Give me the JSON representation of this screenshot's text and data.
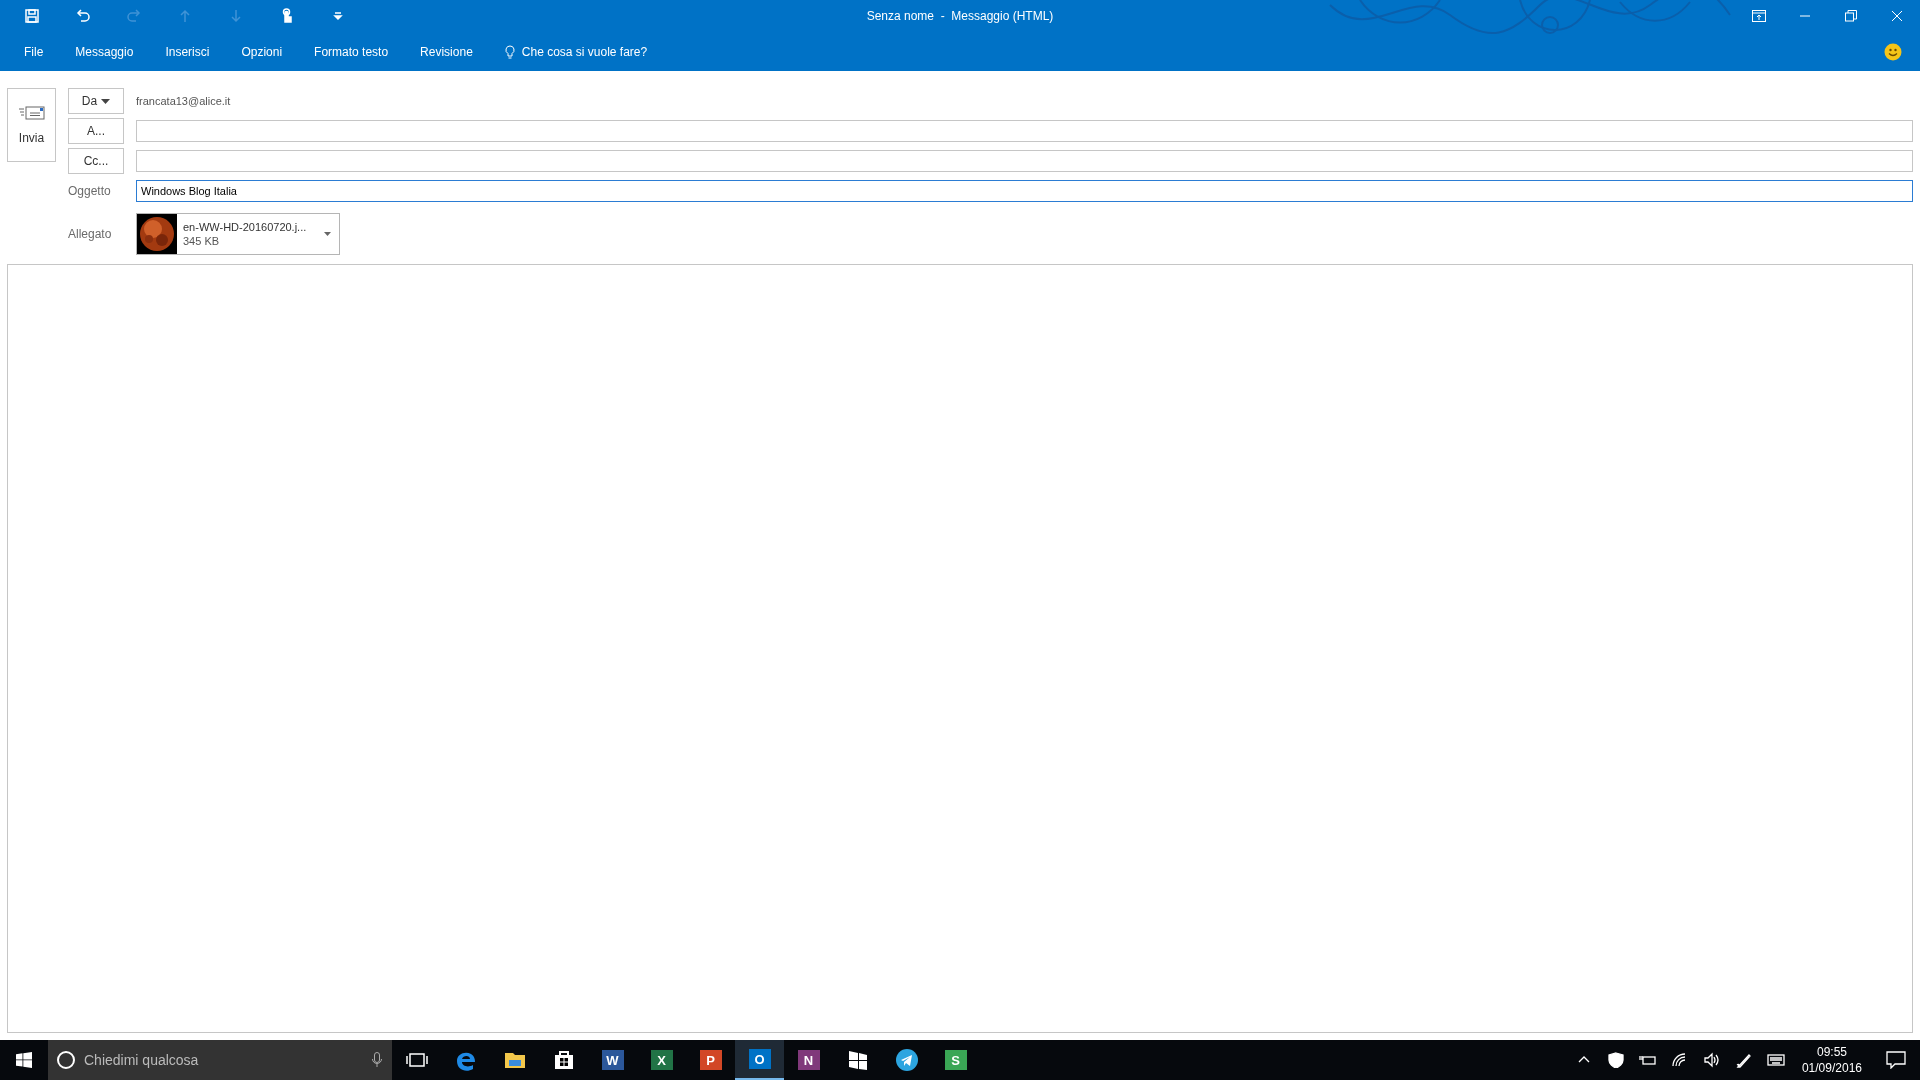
{
  "window": {
    "title": "Senza nome  -  Messaggio (HTML)"
  },
  "ribbon_tabs": [
    {
      "label": "File",
      "selected": false
    },
    {
      "label": "Messaggio",
      "selected": false
    },
    {
      "label": "Inserisci",
      "selected": false
    },
    {
      "label": "Opzioni",
      "selected": false
    },
    {
      "label": "Formato testo",
      "selected": false
    },
    {
      "label": "Revisione",
      "selected": false
    }
  ],
  "tell_me": {
    "placeholder": "Che cosa si vuole fare?"
  },
  "quick_access": [
    {
      "kind": "save",
      "disabled": false
    },
    {
      "kind": "undo",
      "disabled": false
    },
    {
      "kind": "redo",
      "disabled": true
    },
    {
      "kind": "up",
      "disabled": true
    },
    {
      "kind": "down",
      "disabled": true
    },
    {
      "kind": "touch",
      "disabled": false
    },
    {
      "kind": "customize",
      "disabled": false
    }
  ],
  "send_button": {
    "label": "Invia"
  },
  "from": {
    "label": "Da",
    "value": "francata13@alice.it"
  },
  "to": {
    "label": "A..."
  },
  "cc": {
    "label": "Cc..."
  },
  "subject": {
    "label": "Oggetto",
    "value": "Windows Blog Italia"
  },
  "attachment": {
    "label": "Allegato",
    "name": "en-WW-HD-20160720.j...",
    "size": "345 KB"
  },
  "taskbar": {
    "search": {
      "placeholder": "Chiedimi qualcosa"
    },
    "apps": [
      {
        "kind": "taskview",
        "selected": false
      },
      {
        "kind": "edge",
        "selected": false
      },
      {
        "kind": "explorer",
        "selected": false
      },
      {
        "kind": "store",
        "selected": false
      },
      {
        "kind": "tile",
        "glyph": "W",
        "color": "#2b579a",
        "selected": false
      },
      {
        "kind": "tile",
        "glyph": "X",
        "color": "#217346",
        "selected": false
      },
      {
        "kind": "tile",
        "glyph": "P",
        "color": "#d24726",
        "selected": false
      },
      {
        "kind": "tile",
        "glyph": "O",
        "color": "#0072c6",
        "selected": true
      },
      {
        "kind": "tile",
        "glyph": "N",
        "color": "#80397b",
        "selected": false
      },
      {
        "kind": "flag",
        "selected": false
      },
      {
        "kind": "telegram",
        "selected": false
      },
      {
        "kind": "tile",
        "glyph": "S",
        "color": "#3aa655",
        "selected": false
      }
    ],
    "time": "09:55",
    "date": "01/09/2016"
  }
}
